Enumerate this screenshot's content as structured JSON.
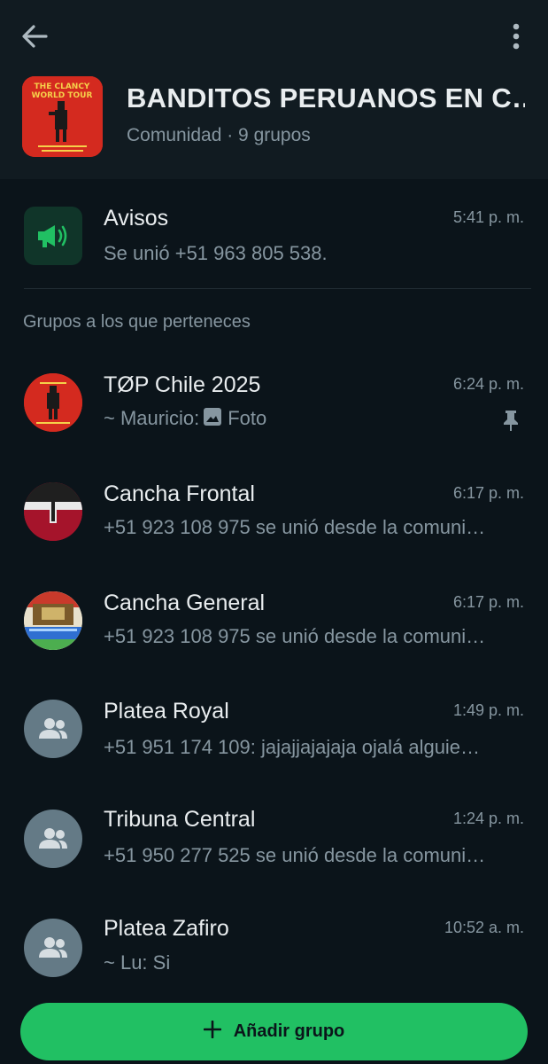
{
  "header": {
    "community_name": "BANDITOS PERUANOS EN C…",
    "community_meta": "Comunidad · 9 grupos",
    "avatar_text_line1": "THE CLANCY",
    "avatar_text_line2": "WORLD TOUR"
  },
  "announcements": {
    "title": "Avisos",
    "time": "5:41 p. m.",
    "last_message": "Se unió +51 963 805 538."
  },
  "section_label": "Grupos a los que perteneces",
  "groups": [
    {
      "name": "TØP Chile 2025",
      "time": "6:24 p. m.",
      "sender": "~ Mauricio:",
      "message": "Foto",
      "pinned": true
    },
    {
      "name": "Cancha Frontal",
      "time": "6:17 p. m.",
      "message": "+51 923 108 975 se unió desde la comuni…"
    },
    {
      "name": "Cancha General",
      "time": "6:17 p. m.",
      "message": "+51 923 108 975 se unió desde la comuni…"
    },
    {
      "name": "Platea Royal",
      "time": "1:49 p. m.",
      "message": "+51 951 174 109: jajajjajajaja ojalá alguie…"
    },
    {
      "name": "Tribuna Central",
      "time": "1:24 p. m.",
      "message": "+51 950 277 525 se unió desde la comuni…"
    },
    {
      "name": "Platea Zafiro",
      "time": "10:52 a. m.",
      "message": "~ Lu: Si"
    }
  ],
  "add_button_label": "Añadir grupo",
  "colors": {
    "background": "#0b141a",
    "header": "#111b21",
    "accent": "#21c063",
    "muted_text": "#8696a0"
  }
}
